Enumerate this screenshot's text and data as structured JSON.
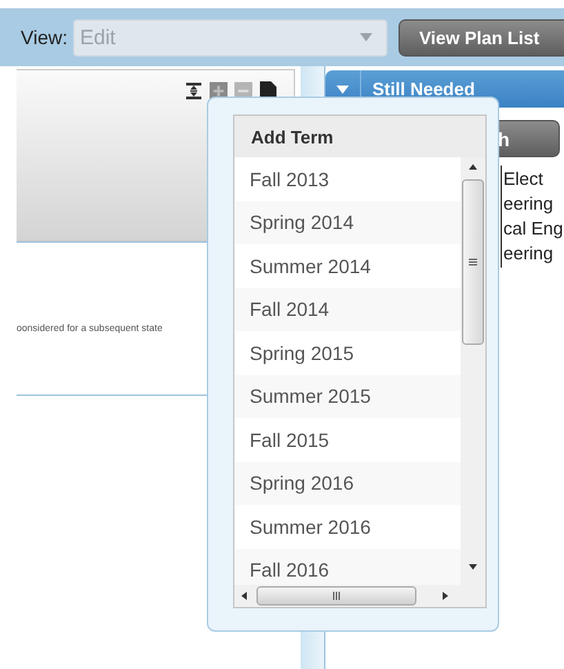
{
  "toolbar": {
    "view_label": "View:",
    "view_select": {
      "value": "Edit"
    },
    "plan_list_button": "View Plan List"
  },
  "left_panel": {
    "note": "oonsidered for a subsequent state"
  },
  "right_panel": {
    "header": "Still Needed",
    "expanded": true,
    "button": "h",
    "lines": [
      "Elect",
      "eering",
      "cal Eng",
      "eering"
    ]
  },
  "add_term_popup": {
    "header": "Add Term",
    "terms": [
      {
        "label": "Fall 2013"
      },
      {
        "label": "Spring 2014"
      },
      {
        "label": "Summer 2014"
      },
      {
        "label": "Fall 2014"
      },
      {
        "label": "Spring 2015"
      },
      {
        "label": "Summer 2015"
      },
      {
        "label": "Fall 2015"
      },
      {
        "label": "Spring 2016"
      },
      {
        "label": "Summer 2016"
      },
      {
        "label": "Fall 2016"
      }
    ]
  }
}
